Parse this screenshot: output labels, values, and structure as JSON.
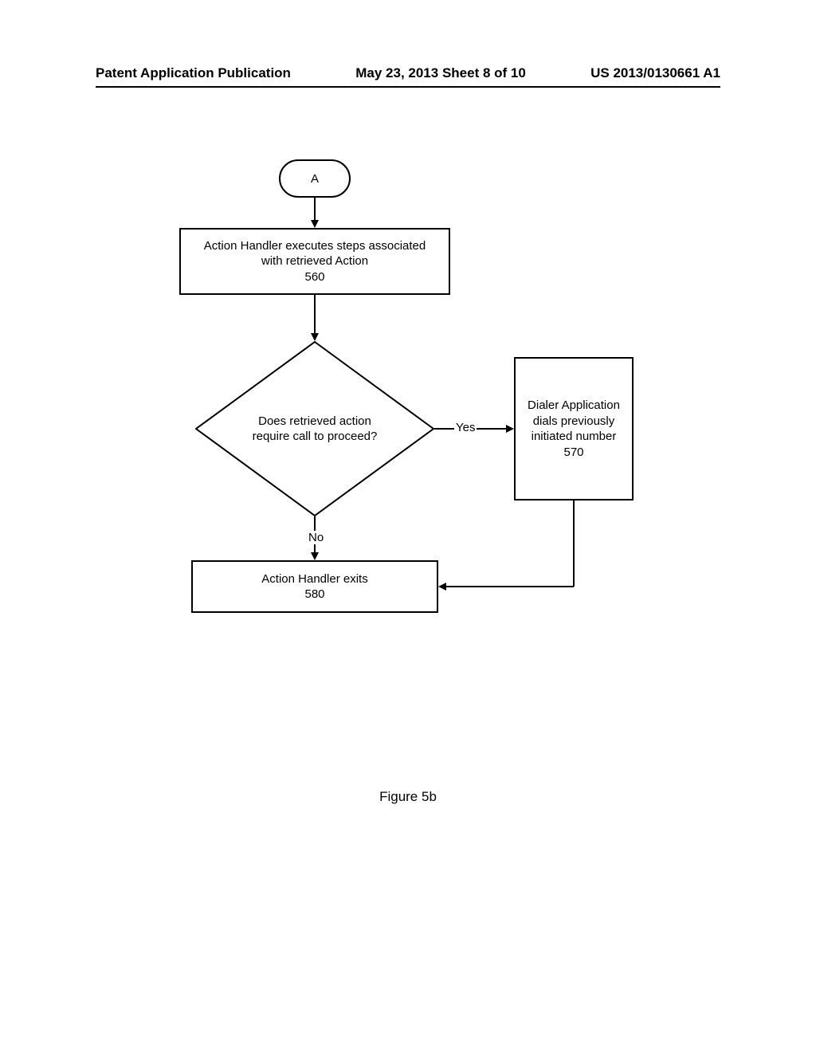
{
  "header": {
    "left": "Patent Application Publication",
    "center": "May 23, 2013  Sheet 8 of 10",
    "right": "US 2013/0130661 A1"
  },
  "nodes": {
    "connector": "A",
    "step560_line1": "Action Handler executes steps associated",
    "step560_line2": "with retrieved Action",
    "step560_num": "560",
    "decision_line1": "Does retrieved action",
    "decision_line2": "require call to proceed?",
    "step570_line1": "Dialer Application",
    "step570_line2": "dials previously",
    "step570_line3": "initiated number",
    "step570_num": "570",
    "step580_line1": "Action Handler exits",
    "step580_num": "580"
  },
  "edges": {
    "yes": "Yes",
    "no": "No"
  },
  "caption": "Figure 5b"
}
